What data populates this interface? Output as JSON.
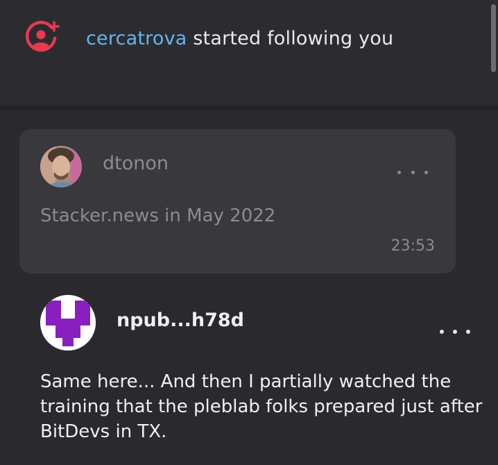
{
  "notification": {
    "icon": "add-user-icon",
    "username": "cercatrova",
    "action_text": " started following you",
    "icon_color": "#e8394f",
    "username_color": "#64b5f0"
  },
  "quoted_note": {
    "author": "dtonon",
    "content": "Stacker.news in May 2022",
    "time": "23:53",
    "more_icon": "more-horizontal-icon"
  },
  "note": {
    "author": "npub...h78d",
    "content": "Same here... And then I partially watched the training that the pleblab folks prepared just after BitDevs in TX.",
    "avatar_color": "#8a1fbf",
    "more_icon": "more-horizontal-icon"
  },
  "theme": {
    "background": "#2a2a2e",
    "card_background": "#38383d"
  }
}
